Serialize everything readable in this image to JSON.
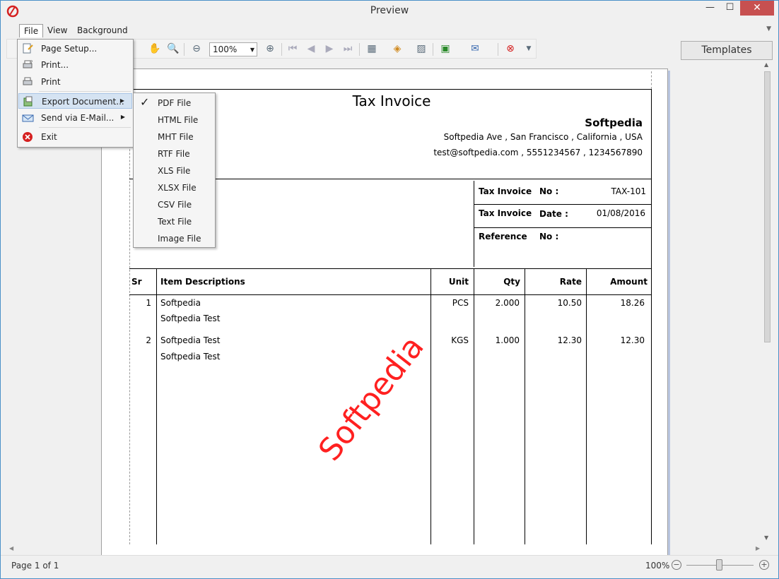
{
  "window": {
    "title": "Preview"
  },
  "menubar": {
    "file": "File",
    "view": "View",
    "background": "Background"
  },
  "toolbar": {
    "zoom_value": "100%"
  },
  "templates_label": "Templates",
  "file_menu": [
    {
      "label": "Page Setup...",
      "icon": "page-setup-icon"
    },
    {
      "label": "Print...",
      "icon": "print-dialog-icon"
    },
    {
      "label": "Print",
      "icon": "print-icon"
    },
    {
      "label": "Export Document...",
      "icon": "export-icon",
      "submenu": true
    },
    {
      "label": "Send via E-Mail...",
      "icon": "email-icon",
      "submenu": true
    },
    {
      "label": "Exit",
      "icon": "exit-icon"
    }
  ],
  "export_menu": [
    {
      "label": "PDF File",
      "checked": true
    },
    {
      "label": "HTML File"
    },
    {
      "label": "MHT File"
    },
    {
      "label": "RTF File"
    },
    {
      "label": "XLS File"
    },
    {
      "label": "XLSX File"
    },
    {
      "label": "CSV File"
    },
    {
      "label": "Text File"
    },
    {
      "label": "Image File"
    }
  ],
  "invoice": {
    "title": "Tax Invoice",
    "company": "Softpedia",
    "address": "Softpedia Ave , San Francisco , California , USA",
    "contact": "test@softpedia.com , 5551234567 , 1234567890",
    "meta": {
      "no_label_a": "Tax Invoice",
      "no_label_b": "No :",
      "no_value": "TAX-101",
      "date_label_a": "Tax Invoice",
      "date_label_b": "Date :",
      "date_value": "01/08/2016",
      "ref_label_a": "Reference",
      "ref_label_b": "No :"
    },
    "columns": {
      "sr": "Sr",
      "desc": "Item Descriptions",
      "unit": "Unit",
      "qty": "Qty",
      "rate": "Rate",
      "amount": "Amount"
    },
    "rows": [
      {
        "sr": "1",
        "desc": "Softpedia",
        "desc2": "Softpedia Test",
        "unit": "PCS",
        "qty": "2.000",
        "rate": "10.50",
        "amount": "18.26"
      },
      {
        "sr": "2",
        "desc": "Softpedia Test",
        "desc2": "Softpedia Test",
        "unit": "KGS",
        "qty": "1.000",
        "rate": "12.30",
        "amount": "12.30"
      }
    ],
    "watermark": "Softpedia"
  },
  "status": {
    "page_info": "Page 1 of 1",
    "zoom": "100%"
  }
}
